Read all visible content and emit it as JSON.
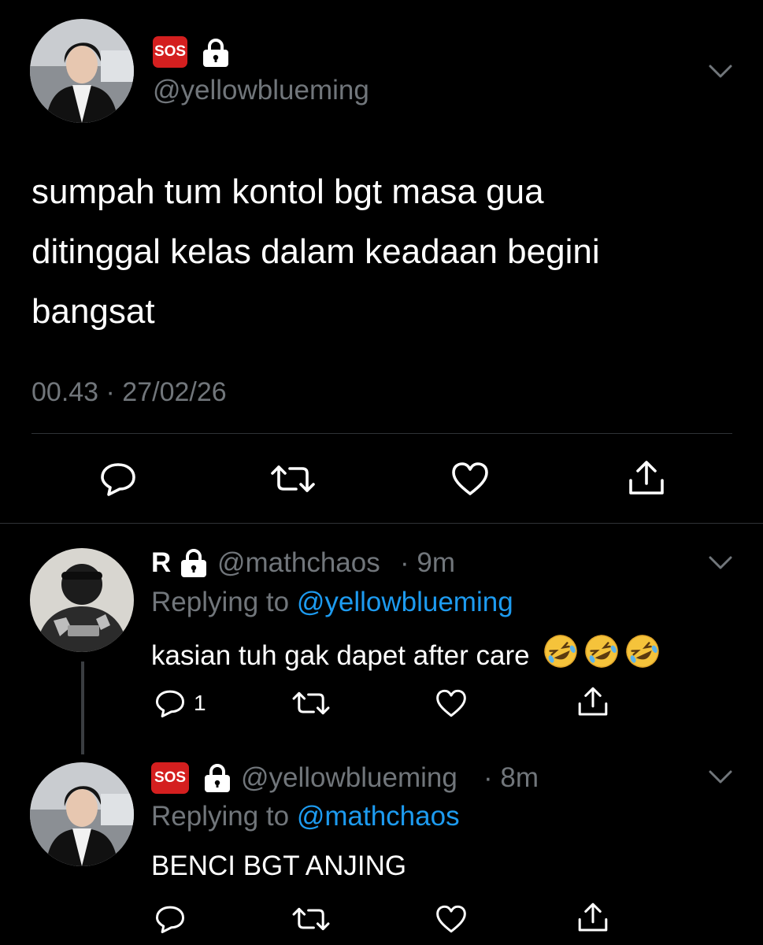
{
  "main_tweet": {
    "badge": "SOS",
    "handle": "@yellowblueming",
    "text_lines": [
      "sumpah tum kontol bgt masa gua",
      "ditinggal kelas dalam keadaan begini",
      "bangsat"
    ],
    "timestamp": "00.43 · 27/02/26"
  },
  "replies": [
    {
      "name": "R",
      "handle": "@mathchaos",
      "time": "· 9m",
      "replying_prefix": "Replying to",
      "replying_to": "@yellowblueming",
      "text": "kasian tuh gak dapet after care",
      "emojis": [
        "rolling-on-floor-laughing",
        "rolling-on-floor-laughing",
        "rolling-on-floor-laughing"
      ],
      "reply_count": "1"
    },
    {
      "badge": "SOS",
      "handle": "@yellowblueming",
      "time": "· 8m",
      "replying_prefix": "Replying to",
      "replying_to": "@mathchaos",
      "text": "BENCI BGT ANJING",
      "reply_count": ""
    }
  ],
  "icons": [
    "chevron-down-icon",
    "lock-icon",
    "reply-icon",
    "retweet-icon",
    "like-icon",
    "share-icon"
  ],
  "colors": {
    "background": "#000000",
    "text": "#ffffff",
    "muted": "#71767b",
    "link": "#1d9bf0",
    "sos": "#d41f1f",
    "divider": "#2f3336"
  }
}
